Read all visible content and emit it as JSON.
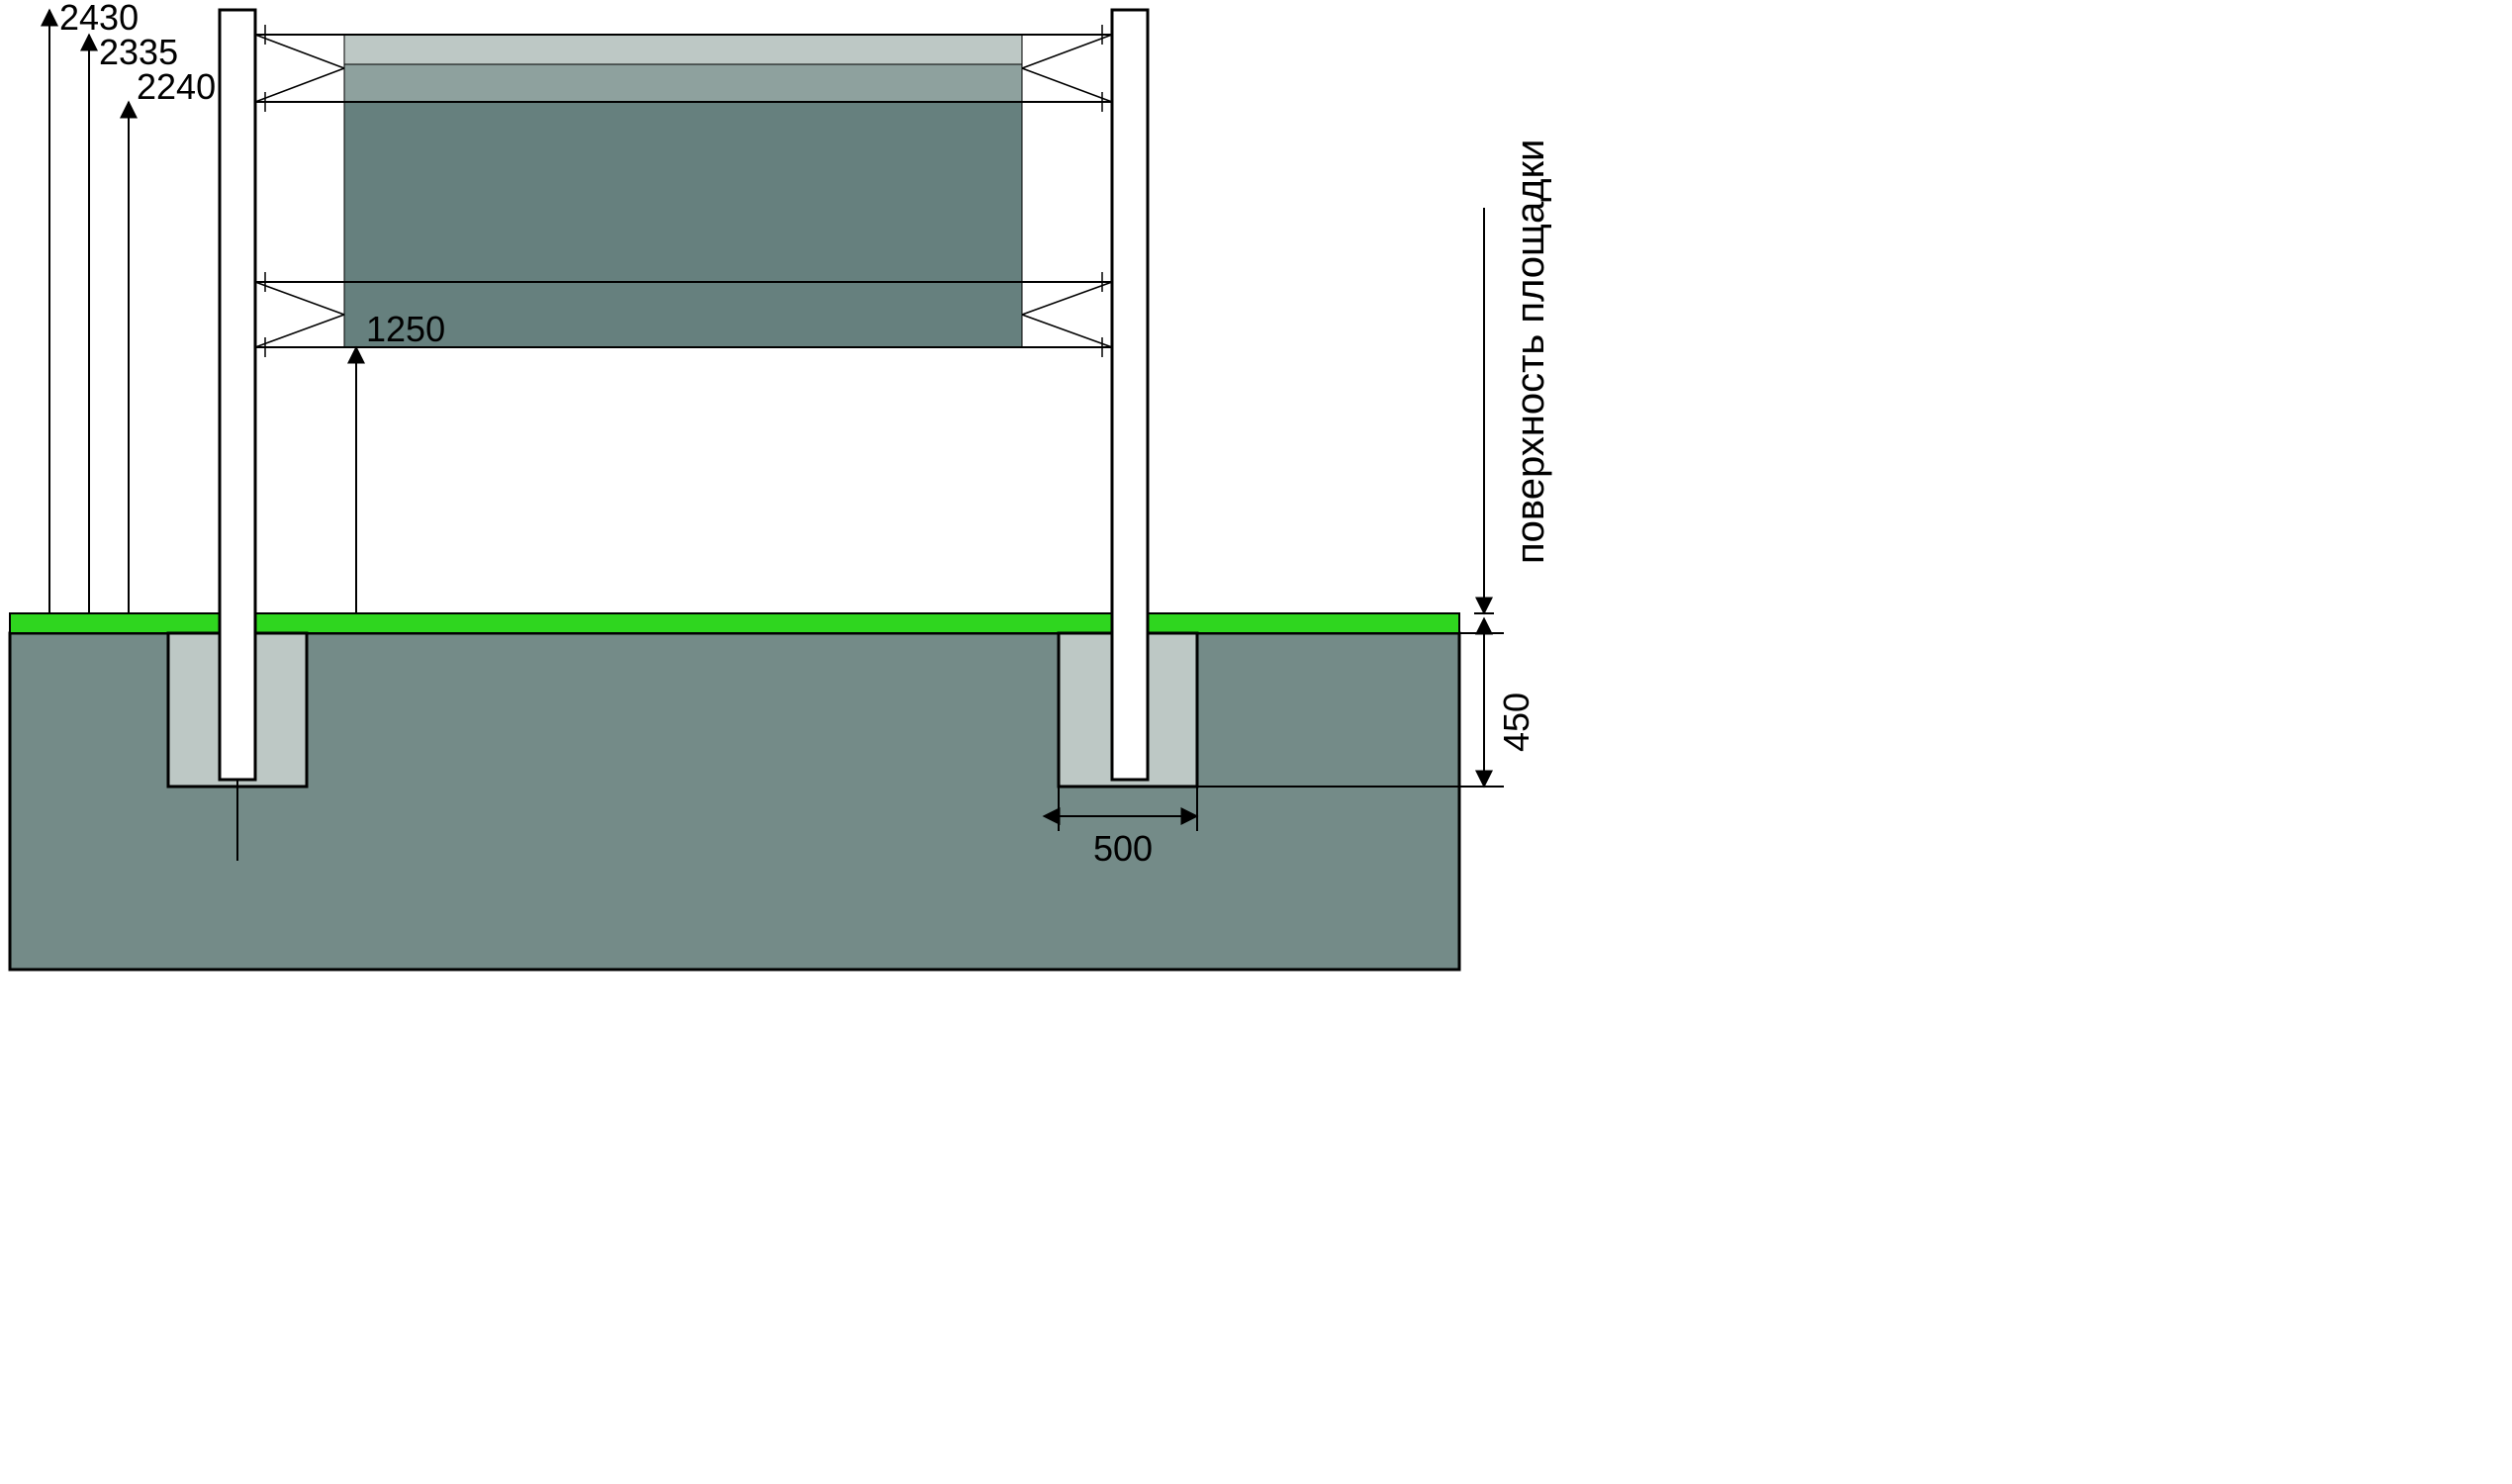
{
  "dimensions": {
    "height_top_of_post": "2430",
    "height_top_rail_upper": "2335",
    "height_top_rail_lower": "2240",
    "height_bottom_rail": "1250",
    "foundation_depth": "450",
    "foundation_width": "500"
  },
  "labels": {
    "ground_surface": "поверхность площадки"
  },
  "colors": {
    "ground_fill": "#748b88",
    "panel_dark": "#66807e",
    "panel_light": "#bdc8c5",
    "grass": "#2fd61f",
    "post_fill": "#ffffff",
    "outline": "#000000"
  }
}
